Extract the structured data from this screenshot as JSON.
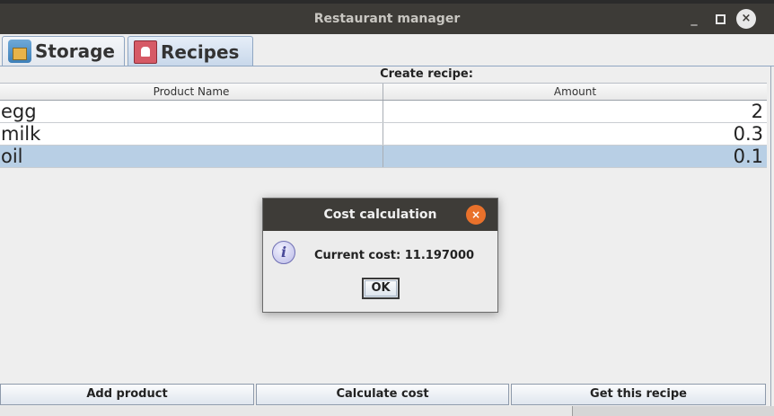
{
  "window": {
    "title": "Restaurant manager",
    "minimize_label": "_",
    "close_label": "×"
  },
  "tabs": [
    {
      "label": "Storage",
      "icon": "storage-icon"
    },
    {
      "label": "Recipes",
      "icon": "recipe-book-icon"
    }
  ],
  "recipe_panel": {
    "title": "Create recipe:",
    "columns": [
      "Product Name",
      "Amount"
    ],
    "rows": [
      {
        "product": "egg",
        "amount": "2"
      },
      {
        "product": "milk",
        "amount": "0.3"
      },
      {
        "product": "oil",
        "amount": "0.1",
        "selected": true
      }
    ]
  },
  "buttons": {
    "add_product": "Add product",
    "calculate_cost": "Calculate cost",
    "get_recipe": "Get this recipe"
  },
  "dialog": {
    "title": "Cost calculation",
    "close_label": "×",
    "icon": "info-icon",
    "icon_glyph": "i",
    "message": "Current cost: 11.197000",
    "ok_label": "OK"
  },
  "colors": {
    "titlebar": "#3d3b37",
    "selected_row": "#b8cfe5",
    "dialog_close": "#e9712b"
  }
}
